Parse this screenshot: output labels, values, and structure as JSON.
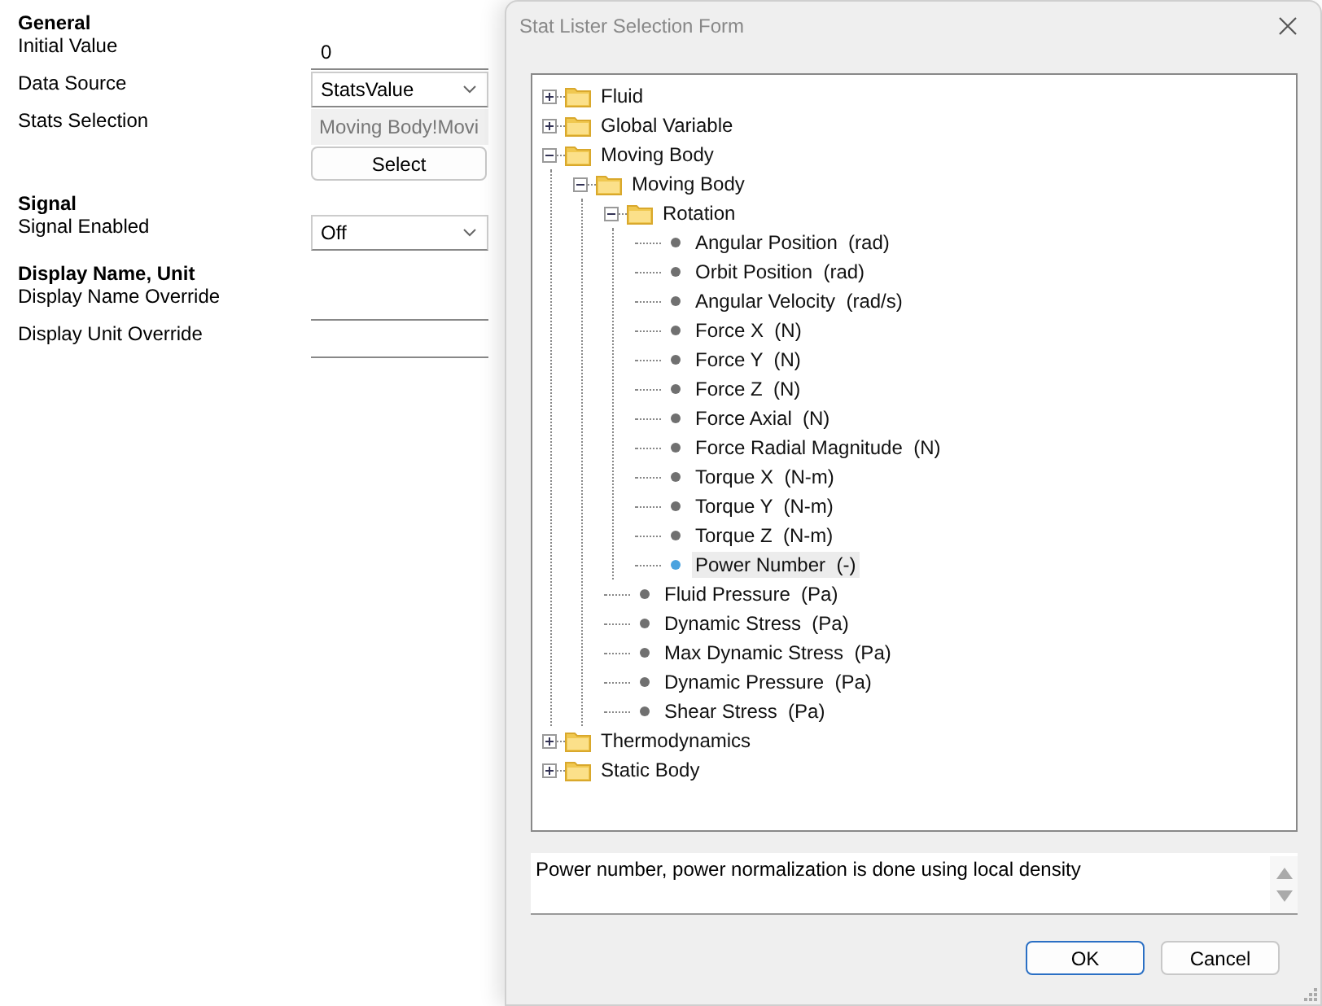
{
  "properties": [
    {
      "heading": "General",
      "fields": [
        {
          "label": "Initial Value",
          "kind": "text",
          "value": "0"
        },
        {
          "label": "Data Source",
          "kind": "dropdown",
          "value": "StatsValue"
        },
        {
          "label": "Stats Selection",
          "kind": "readonly",
          "value": "Moving Body!Movi"
        },
        {
          "kind": "button",
          "text": "Select"
        }
      ]
    },
    {
      "heading": "Signal",
      "fields": [
        {
          "label": "Signal Enabled",
          "kind": "dropdown",
          "value": "Off"
        }
      ]
    },
    {
      "heading": "Display Name, Unit",
      "fields": [
        {
          "label": "Display Name Override",
          "kind": "text"
        },
        {
          "label": "Display Unit Override",
          "kind": "text"
        }
      ]
    }
  ],
  "dialog": {
    "title": "Stat Lister Selection Form",
    "tree": [
      {
        "label": "Fluid",
        "kind": "folder",
        "expanded": false
      },
      {
        "label": "Global Variable",
        "kind": "folder",
        "expanded": false
      },
      {
        "label": "Moving Body",
        "kind": "folder",
        "expanded": true,
        "children": [
          {
            "label": "Moving Body",
            "kind": "folder",
            "expanded": true,
            "children": [
              {
                "label": "Rotation",
                "kind": "folder",
                "expanded": true,
                "children": [
                  {
                    "label": "Angular Position  (rad)",
                    "kind": "stat",
                    "selected": false
                  },
                  {
                    "label": "Orbit Position  (rad)",
                    "kind": "stat",
                    "selected": false
                  },
                  {
                    "label": "Angular Velocity  (rad/s)",
                    "kind": "stat",
                    "selected": false
                  },
                  {
                    "label": "Force X  (N)",
                    "kind": "stat",
                    "selected": false
                  },
                  {
                    "label": "Force Y  (N)",
                    "kind": "stat",
                    "selected": false
                  },
                  {
                    "label": "Force Z  (N)",
                    "kind": "stat",
                    "selected": false
                  },
                  {
                    "label": "Force Axial  (N)",
                    "kind": "stat",
                    "selected": false
                  },
                  {
                    "label": "Force Radial Magnitude  (N)",
                    "kind": "stat",
                    "selected": false
                  },
                  {
                    "label": "Torque X  (N-m)",
                    "kind": "stat",
                    "selected": false
                  },
                  {
                    "label": "Torque Y  (N-m)",
                    "kind": "stat",
                    "selected": false
                  },
                  {
                    "label": "Torque Z  (N-m)",
                    "kind": "stat",
                    "selected": false
                  },
                  {
                    "label": "Power Number  (-)",
                    "kind": "stat",
                    "selected": true
                  }
                ]
              },
              {
                "label": "Fluid Pressure  (Pa)",
                "kind": "stat",
                "selected": false
              },
              {
                "label": "Dynamic Stress  (Pa)",
                "kind": "stat",
                "selected": false
              },
              {
                "label": "Max Dynamic Stress  (Pa)",
                "kind": "stat",
                "selected": false
              },
              {
                "label": "Dynamic Pressure  (Pa)",
                "kind": "stat",
                "selected": false
              },
              {
                "label": "Shear Stress  (Pa)",
                "kind": "stat",
                "selected": false
              }
            ]
          }
        ]
      },
      {
        "label": "Thermodynamics",
        "kind": "folder",
        "expanded": false
      },
      {
        "label": "Static Body",
        "kind": "folder",
        "expanded": false
      }
    ],
    "description": "Power number, power normalization is done using local density",
    "buttons": [
      {
        "label": "OK",
        "default": true
      },
      {
        "label": "Cancel",
        "default": false
      }
    ]
  }
}
